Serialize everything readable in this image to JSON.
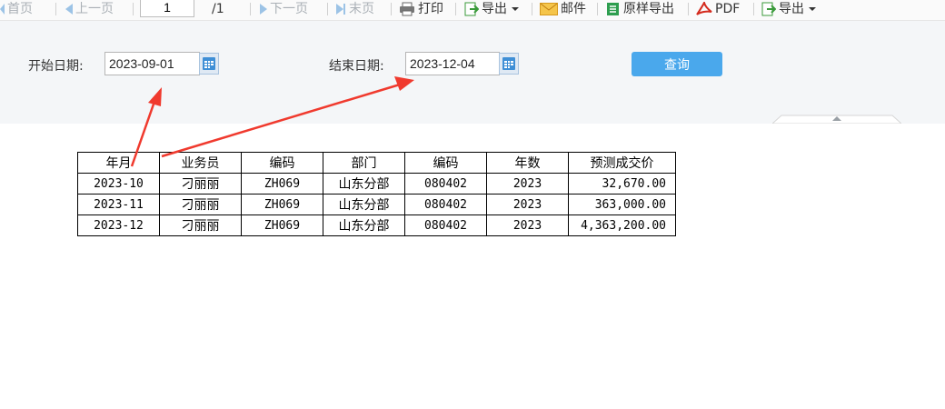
{
  "toolbar": {
    "first_page": "首页",
    "prev_page": "上一页",
    "page_value": "1",
    "page_total": "/1",
    "next_page": "下一页",
    "last_page": "末页",
    "print": "打印",
    "export1": "导出",
    "mail": "邮件",
    "raw_export": "原样导出",
    "pdf": "PDF",
    "export2": "导出"
  },
  "filter": {
    "start_label": "开始日期:",
    "start_value": "2023-09-01",
    "end_label": "结束日期:",
    "end_value": "2023-12-04",
    "query_label": "查询"
  },
  "table": {
    "headers": [
      "年月",
      "业务员",
      "编码",
      "部门",
      "编码",
      "年数",
      "预测成交价"
    ],
    "rows": [
      [
        "2023-10",
        "刁丽丽",
        "ZH069",
        "山东分部",
        "080402",
        "2023",
        "32,670.00"
      ],
      [
        "2023-11",
        "刁丽丽",
        "ZH069",
        "山东分部",
        "080402",
        "2023",
        "363,000.00"
      ],
      [
        "2023-12",
        "刁丽丽",
        "ZH069",
        "山东分部",
        "080402",
        "2023",
        "4,363,200.00"
      ]
    ]
  },
  "colors": {
    "annotation_arrow": "#f03a2e",
    "query_button": "#4aa8ec"
  }
}
